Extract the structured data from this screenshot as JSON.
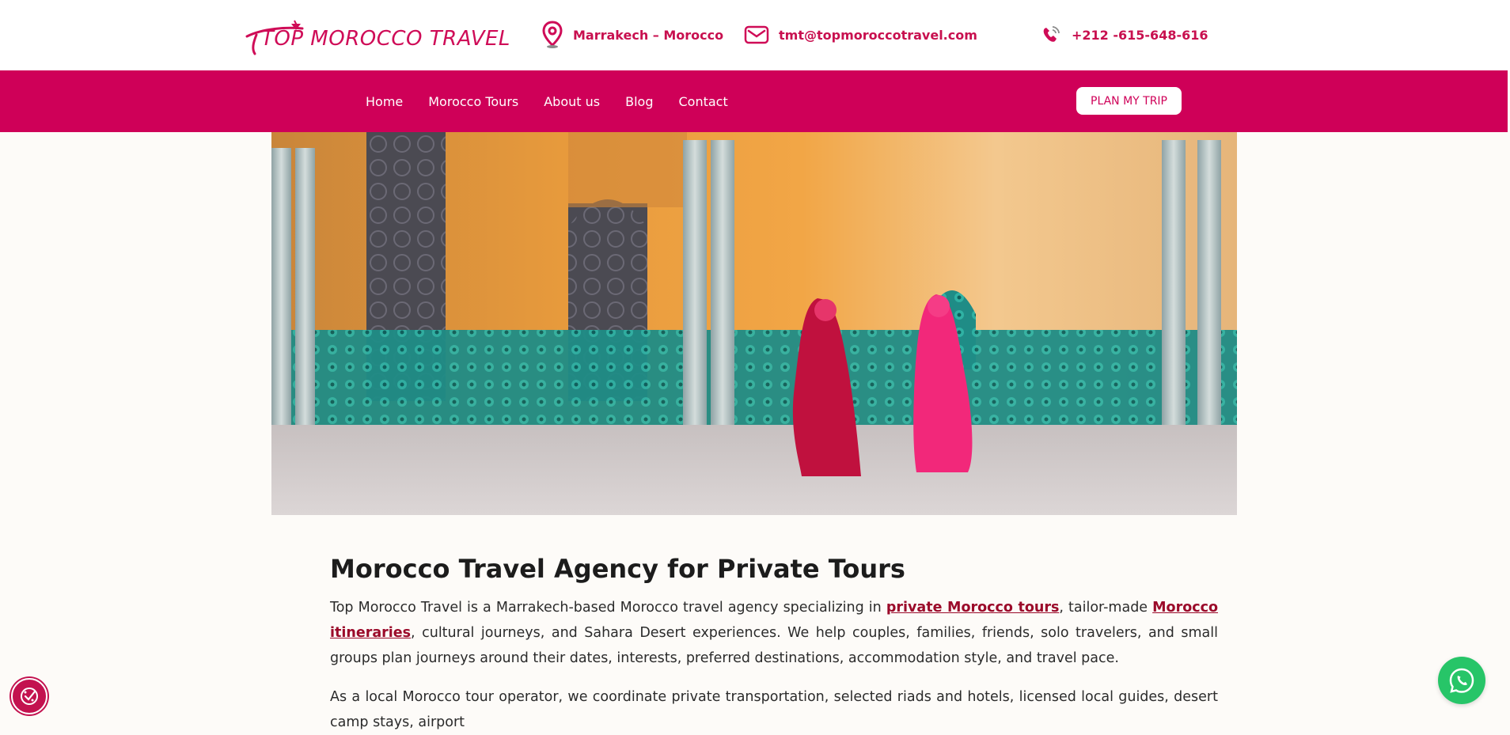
{
  "header": {
    "logo_text": "TOP MOROCCO TRAVEL",
    "location": "Marrakech – Morocco",
    "email": "tmt@topmoroccotravel.com",
    "phone": "+212 -615-648-616"
  },
  "nav": {
    "items": [
      "Home",
      "Morocco Tours",
      "About us",
      "Blog",
      "Contact"
    ],
    "cta": "PLAN MY TRIP"
  },
  "content": {
    "heading": "Morocco Travel Agency for Private Tours",
    "p1_a": "Top Morocco Travel is a Marrakech-based Morocco travel agency specializing in ",
    "p1_link1": "private Morocco tours",
    "p1_b": ", tailor-made ",
    "p1_link2": "Morocco itineraries",
    "p1_c": ", cultural journeys, and Sahara Desert experiences. We help couples, families, friends, solo travelers, and small groups plan journeys around their dates, interests, preferred destinations, accommodation style, and travel pace.",
    "p2": "As a local Morocco tour operator, we coordinate private transportation, selected riads and hotels, licensed local guides, desert camp stays, airport"
  },
  "colors": {
    "brand": "#cf0058",
    "link": "#9b0a2a",
    "whatsapp": "#27c568"
  },
  "icons": {
    "location": "map-pin-icon",
    "email": "envelope-icon",
    "phone": "phone-icon",
    "cookie": "cookie-consent-icon",
    "whatsapp": "whatsapp-icon"
  }
}
